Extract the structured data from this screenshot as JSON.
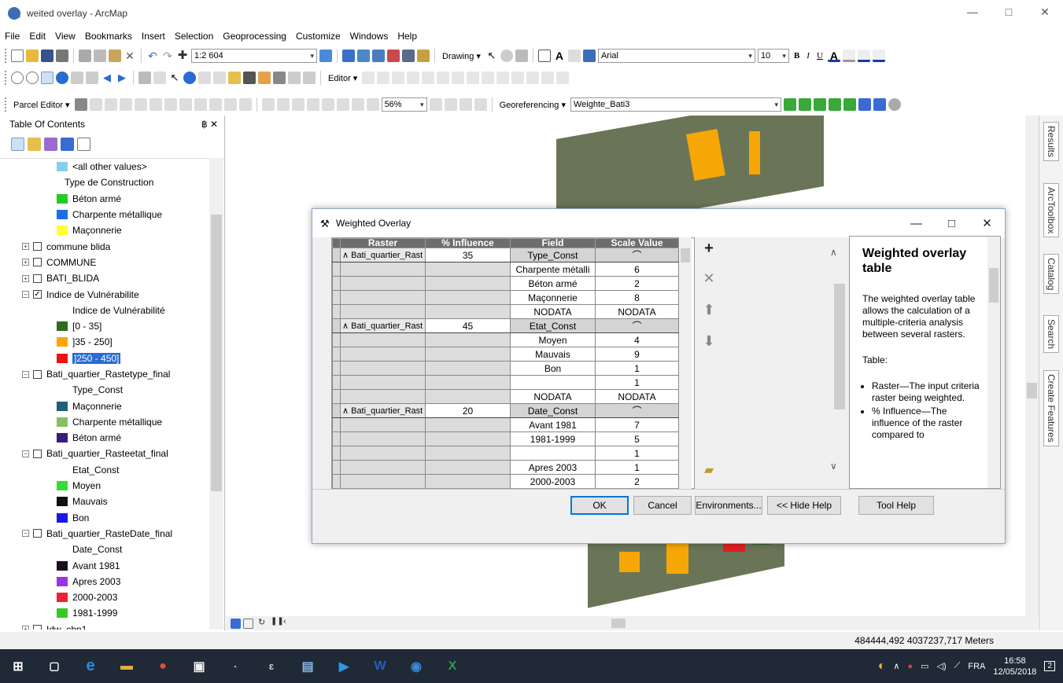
{
  "window": {
    "title": "weited overlay - ArcMap",
    "minimize": "—",
    "maximize": "□",
    "close": "✕"
  },
  "menu": [
    "File",
    "Edit",
    "View",
    "Bookmarks",
    "Insert",
    "Selection",
    "Geoprocessing",
    "Customize",
    "Windows",
    "Help"
  ],
  "toolbar1": {
    "scale": "1:2 604",
    "drawing_label": "Drawing ▾",
    "font_name": "Arial",
    "font_size": "10",
    "bold": "B",
    "italic": "I",
    "underline": "U"
  },
  "toolbar2": {
    "editor_label": "Editor ▾"
  },
  "toolbar3": {
    "parcel_editor_label": "Parcel Editor ▾",
    "zoom_percent": "56%",
    "georef_label": "Georeferencing ▾",
    "georef_layer": "Weighte_Bati3"
  },
  "toc": {
    "title": "Table Of Contents",
    "pin": "฿ ✕",
    "rows": [
      {
        "indent": 72,
        "swatch": "#87ceeb",
        "label": "<all other values>"
      },
      {
        "indent": 82,
        "label": "Type de Construction"
      },
      {
        "indent": 72,
        "swatch": "#22cc22",
        "label": "Béton armé"
      },
      {
        "indent": 72,
        "swatch": "#1e6fe6",
        "label": "Charpente métallique"
      },
      {
        "indent": 72,
        "swatch": "#ffff33",
        "label": "Maçonnerie"
      },
      {
        "indent": 28,
        "exp": "+",
        "chk": "",
        "label": "commune blida"
      },
      {
        "indent": 28,
        "exp": "+",
        "chk": "",
        "label": "COMMUNE"
      },
      {
        "indent": 28,
        "exp": "+",
        "chk": "",
        "label": "BATI_BLIDA"
      },
      {
        "indent": 28,
        "exp": "−",
        "chk": "✓",
        "label": "Indice de Vulnérabilite"
      },
      {
        "indent": 92,
        "label": "Indice de Vulnérabilité"
      },
      {
        "indent": 72,
        "swatch": "#2e6b1a",
        "label": "[0 - 35]"
      },
      {
        "indent": 72,
        "swatch": "#ffa500",
        "label": "]35 - 250]"
      },
      {
        "indent": 72,
        "swatch": "#ee1111",
        "label": "]250 - 450]",
        "selected": true
      },
      {
        "indent": 28,
        "exp": "−",
        "chk": "",
        "label": "Bati_quartier_Rastetype_final"
      },
      {
        "indent": 92,
        "label": "Type_Const"
      },
      {
        "indent": 72,
        "swatch": "#1f5f7a",
        "label": "Maçonnerie"
      },
      {
        "indent": 72,
        "swatch": "#88c060",
        "label": "Charpente métallique"
      },
      {
        "indent": 72,
        "swatch": "#3a1a7a",
        "label": "Béton armé"
      },
      {
        "indent": 28,
        "exp": "−",
        "chk": "",
        "label": "Bati_quartier_Rasteetat_final"
      },
      {
        "indent": 92,
        "label": "Etat_Const"
      },
      {
        "indent": 72,
        "swatch": "#33dd33",
        "label": "Moyen"
      },
      {
        "indent": 72,
        "swatch": "#111111",
        "label": "Mauvais"
      },
      {
        "indent": 72,
        "swatch": "#1a1ae6",
        "label": "Bon"
      },
      {
        "indent": 28,
        "exp": "−",
        "chk": "",
        "label": "Bati_quartier_RasteDate_final"
      },
      {
        "indent": 92,
        "label": "Date_Const"
      },
      {
        "indent": 72,
        "swatch": "#1a0f22",
        "label": "Avant 1981"
      },
      {
        "indent": 72,
        "swatch": "#9a33e6",
        "label": "Apres 2003"
      },
      {
        "indent": 72,
        "swatch": "#ee2233",
        "label": "2000-2003"
      },
      {
        "indent": 72,
        "swatch": "#33cc22",
        "label": "1981-1999"
      },
      {
        "indent": 28,
        "exp": "+",
        "chk": "",
        "label": "Idw_cbn1"
      }
    ]
  },
  "dialog": {
    "title": "Weighted Overlay",
    "minimize": "—",
    "maximize": "□",
    "close": "✕",
    "columns": [
      "Raster",
      "% Influence",
      "Field",
      "Scale Value"
    ],
    "groups": [
      {
        "raster": "∧ Bati_quartier_Rast",
        "influence": "35",
        "field": "Type_Const",
        "rows": [
          {
            "field": "Charpente métalli",
            "scale": "6"
          },
          {
            "field": "Béton armé",
            "scale": "2"
          },
          {
            "field": "Maçonnerie",
            "scale": "8"
          },
          {
            "field": "NODATA",
            "scale": "NODATA"
          }
        ]
      },
      {
        "raster": "∧ Bati_quartier_Rast",
        "influence": "45",
        "field": "Etat_Const",
        "rows": [
          {
            "field": "Moyen",
            "scale": "4"
          },
          {
            "field": "Mauvais",
            "scale": "9"
          },
          {
            "field": "Bon",
            "scale": "1"
          },
          {
            "field": "",
            "scale": "1"
          },
          {
            "field": "NODATA",
            "scale": "NODATA"
          }
        ]
      },
      {
        "raster": "∧ Bati_quartier_Rast",
        "influence": "20",
        "field": "Date_Const",
        "rows": [
          {
            "field": "Avant 1981",
            "scale": "7"
          },
          {
            "field": "1981-1999",
            "scale": "5"
          },
          {
            "field": "",
            "scale": "1"
          },
          {
            "field": "Apres 2003",
            "scale": "1"
          },
          {
            "field": "2000-2003",
            "scale": "2"
          }
        ]
      }
    ],
    "help": {
      "title": "Weighted overlay table",
      "para1": "The weighted overlay table allows the calculation of a multiple-criteria analysis between several rasters.",
      "para2": "Table:",
      "bullets": [
        "Raster—The input criteria raster being weighted.",
        "% Influence—The influence of the raster compared to"
      ]
    },
    "buttons": {
      "ok": "OK",
      "cancel": "Cancel",
      "environments": "Environments...",
      "hide_help": "<< Hide Help",
      "tool_help": "Tool Help"
    }
  },
  "side_tabs": [
    "Results",
    "ArcToolbox",
    "Catalog",
    "Search",
    "Create Features"
  ],
  "status": {
    "coords": "484444,492  4037237,717 Meters"
  },
  "taskbar": {
    "lang": "FRA",
    "time": "16:58",
    "date": "12/05/2018",
    "notif": "2"
  }
}
